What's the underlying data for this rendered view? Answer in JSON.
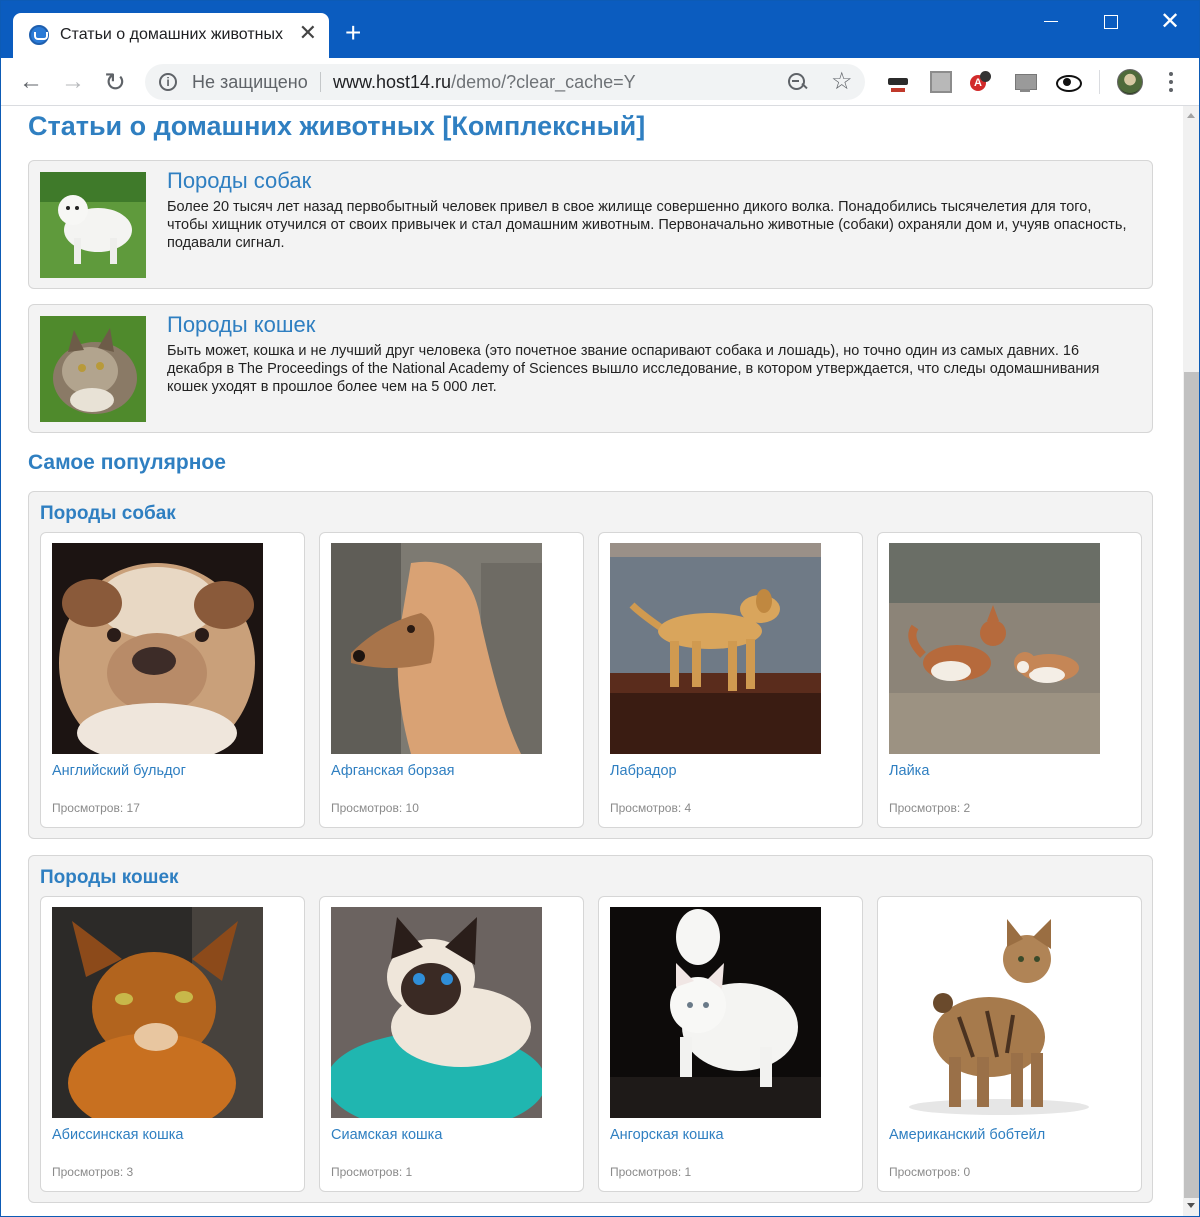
{
  "browser": {
    "tab_title": "Статьи о домашних животных",
    "tab_close": "✕",
    "new_tab": "+",
    "window_close": "✕",
    "nav_back": "←",
    "nav_forward": "→",
    "nav_reload": "↻",
    "info_icon": "i",
    "security_label": "Не защищено",
    "url_host": "www.host14.ru",
    "url_path": "/demo/?clear_cache=Y",
    "star_icon": "☆"
  },
  "page": {
    "title": "Статьи о домашних животных [Комплексный]",
    "articles": [
      {
        "title": "Породы собак",
        "text": "Более 20 тысяч лет назад первобытный человек привел в свое жилище совершенно дикого волка. Понадобились тысячелетия для того, чтобы хищник отучился от своих привычек и стал домашним животным. Первоначально животные (собаки) охраняли дом и, учуяв опасность, подавали сигнал."
      },
      {
        "title": "Породы кошек",
        "text": "Быть может, кошка и не лучший друг человека (это почетное звание оспаривают собака и лошадь), но точно один из самых давних. 16 декабря в The Proceedings of the National Academy of Sciences вышло исследование, в котором утверждается, что следы одомашнивания кошек уходят в прошлое более чем на 5 000 лет."
      }
    ],
    "popular_title": "Самое популярное",
    "sections": [
      {
        "title": "Породы собак",
        "items": [
          {
            "name": "Английский бульдог",
            "views": "Просмотров: 17"
          },
          {
            "name": "Афганская борзая",
            "views": "Просмотров: 10"
          },
          {
            "name": "Лабрадор",
            "views": "Просмотров: 4"
          },
          {
            "name": "Лайка",
            "views": "Просмотров: 2"
          }
        ]
      },
      {
        "title": "Породы кошек",
        "items": [
          {
            "name": "Абиссинская кошка",
            "views": "Просмотров: 3"
          },
          {
            "name": "Сиамская кошка",
            "views": "Просмотров: 1"
          },
          {
            "name": "Ангорская кошка",
            "views": "Просмотров: 1"
          },
          {
            "name": "Американский бобтейл",
            "views": "Просмотров: 0"
          }
        ]
      }
    ]
  },
  "colors": {
    "titlebar": "#0b5cbf",
    "link": "#2f7fc1",
    "panel": "#f3f3f3"
  }
}
